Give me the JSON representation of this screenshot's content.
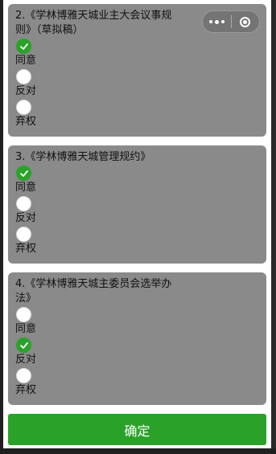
{
  "questions": [
    {
      "title": "2.《学林博雅天城业主大会议事规则》（草拟稿）",
      "options": [
        {
          "label": "同意",
          "checked": true
        },
        {
          "label": "反对",
          "checked": false
        },
        {
          "label": "弃权",
          "checked": false
        }
      ]
    },
    {
      "title": "3.《学林博雅天城管理规约》",
      "options": [
        {
          "label": "同意",
          "checked": true
        },
        {
          "label": "反对",
          "checked": false
        },
        {
          "label": "弃权",
          "checked": false
        }
      ]
    },
    {
      "title": "4.《学林博雅天城主委员会选举办法》",
      "options": [
        {
          "label": "同意",
          "checked": false
        },
        {
          "label": "反对",
          "checked": true
        },
        {
          "label": "弃权",
          "checked": false
        }
      ]
    }
  ],
  "capsule": {
    "more_icon": "more-dots-icon",
    "close_icon": "target-close-icon"
  },
  "confirm_label": "确定",
  "colors": {
    "accent": "#2aa22a",
    "card": "#8a8a8a"
  }
}
